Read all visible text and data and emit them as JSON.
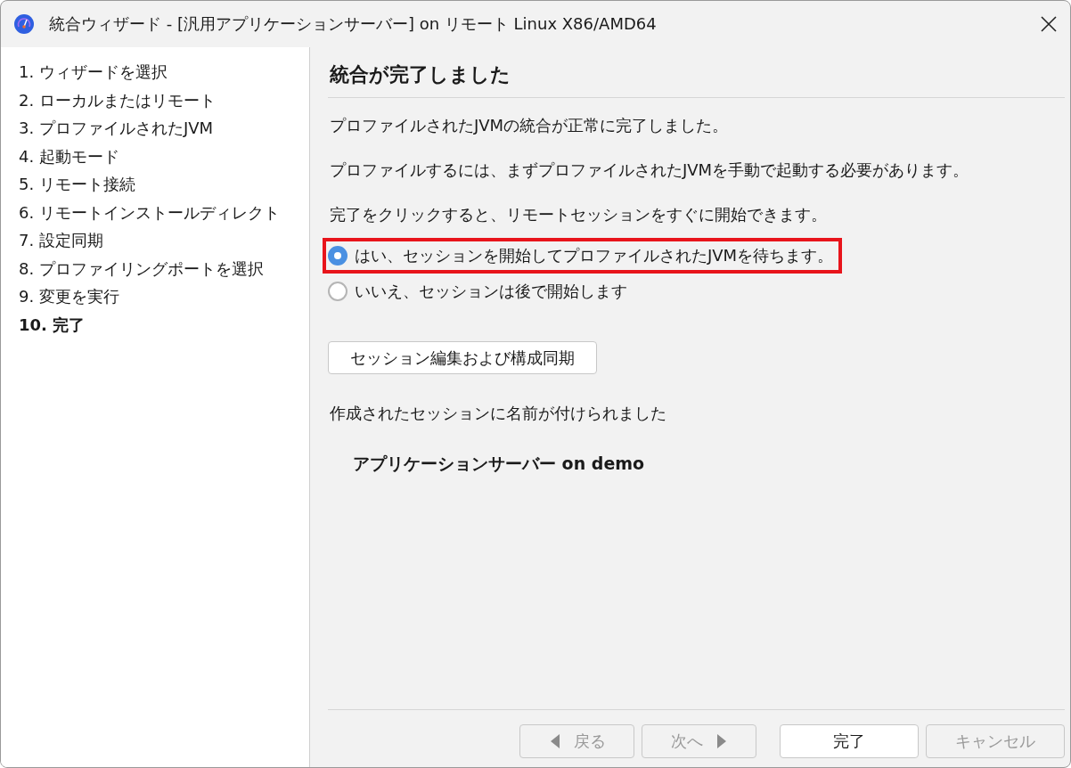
{
  "window": {
    "title": "統合ウィザード - [汎用アプリケーションサーバー] on リモート Linux X86/AMD64"
  },
  "steps": [
    {
      "label": "1. ウィザードを選択",
      "selected": false
    },
    {
      "label": "2. ローカルまたはリモート",
      "selected": false
    },
    {
      "label": "3. プロファイルされたJVM",
      "selected": false
    },
    {
      "label": "4. 起動モード",
      "selected": false
    },
    {
      "label": "5. リモート接続",
      "selected": false
    },
    {
      "label": "6. リモートインストールディレクト",
      "selected": false
    },
    {
      "label": "7. 設定同期",
      "selected": false
    },
    {
      "label": "8. プロファイリングポートを選択",
      "selected": false
    },
    {
      "label": "9. 変更を実行",
      "selected": false
    },
    {
      "label": "10. 完了",
      "selected": true
    }
  ],
  "page": {
    "heading": "統合が完了しました",
    "paragraphs": [
      "プロファイルされたJVMの統合が正常に完了しました。",
      "プロファイルするには、まずプロファイルされたJVMを手動で起動する必要があります。",
      "完了をクリックすると、リモートセッションをすぐに開始できます。"
    ],
    "options": [
      {
        "label": "はい、セッションを開始してプロファイルされたJVMを待ちます。",
        "selected": true,
        "highlighted": true
      },
      {
        "label": "いいえ、セッションは後で開始します",
        "selected": false,
        "highlighted": false
      }
    ],
    "edit_button": "セッション編集および構成同期",
    "session_note": "作成されたセッションに名前が付けられました",
    "session_name": "アプリケーションサーバー on demo"
  },
  "buttons": [
    {
      "label": "戻る",
      "kind": "back",
      "disabled": true
    },
    {
      "label": "次へ",
      "kind": "next",
      "disabled": true
    },
    {
      "label": "完了",
      "kind": "plain",
      "disabled": false
    },
    {
      "label": "キャンセル",
      "kind": "plain",
      "disabled": true
    }
  ]
}
